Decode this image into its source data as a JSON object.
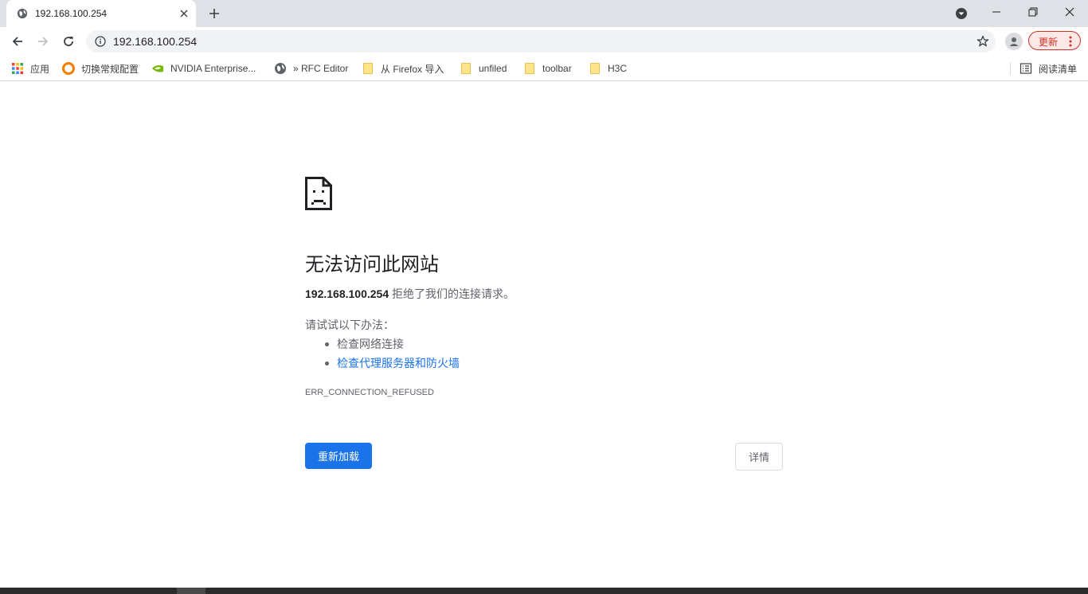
{
  "tab": {
    "title": "192.168.100.254",
    "close_icon": "close-icon",
    "favicon": "globe-icon"
  },
  "new_tab_icon": "plus-icon",
  "window_controls": {
    "minimize": "minimize-icon",
    "restore": "restore-icon",
    "close": "close-icon"
  },
  "toolbar": {
    "url": "192.168.100.254",
    "update_label": "更新",
    "back_icon": "back-arrow-icon",
    "forward_icon": "forward-arrow-icon",
    "reload_icon": "reload-icon"
  },
  "bookmarks": {
    "apps": "应用",
    "items": [
      {
        "label": "切换常规配置",
        "icon": "orange-circle-icon"
      },
      {
        "label": "NVIDIA Enterprise...",
        "icon": "nvidia-icon"
      },
      {
        "label": "» RFC Editor",
        "icon": "globe-icon"
      },
      {
        "label": "从 Firefox 导入",
        "icon": "folder-icon"
      },
      {
        "label": "unfiled",
        "icon": "folder-icon"
      },
      {
        "label": "toolbar",
        "icon": "folder-icon"
      },
      {
        "label": "H3C",
        "icon": "folder-icon"
      }
    ],
    "reading_list": "阅读清单"
  },
  "error": {
    "title": "无法访问此网站",
    "host": "192.168.100.254",
    "desc_suffix": " 拒绝了我们的连接请求。",
    "suggest_head": "请试试以下办法：",
    "suggestions": [
      "检查网络连接",
      "检查代理服务器和防火墙"
    ],
    "code": "ERR_CONNECTION_REFUSED",
    "reload_label": "重新加载",
    "details_label": "详情"
  },
  "colors": {
    "accent": "#1a73e8",
    "update": "#d93025",
    "tabstrip": "#dee1e6"
  }
}
